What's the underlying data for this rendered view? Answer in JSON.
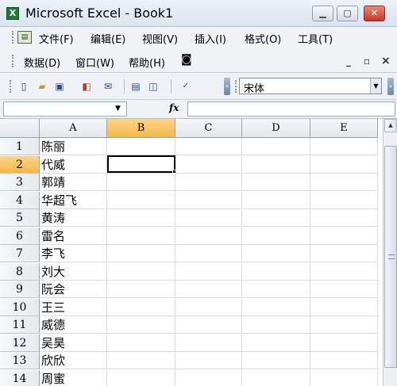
{
  "window": {
    "app_icon": "excel-icon",
    "title": "Microsoft Excel - Book1",
    "minimize_icon": "minimize-icon",
    "maximize_icon": "maximize-icon",
    "close_icon": "close-icon"
  },
  "menubar": {
    "doc_icon": "document-icon",
    "row1": [
      "文件(F)",
      "编辑(E)",
      "视图(V)",
      "插入(I)",
      "格式(O)",
      "工具(T)"
    ],
    "row2": [
      "数据(D)",
      "窗口(W)",
      "帮助(H)"
    ],
    "camera_icon": "camera-icon",
    "mdi_minimize": "_",
    "mdi_restore": "▫",
    "mdi_close": "×"
  },
  "toolbar": {
    "icons": [
      "new-icon",
      "open-icon",
      "save-icon",
      "permission-icon",
      "email-icon",
      "print-icon",
      "print-preview-icon",
      "spelling-icon"
    ],
    "font": "宋体"
  },
  "formula_bar": {
    "name_box": "",
    "fx_label": "fx",
    "formula": ""
  },
  "sheet": {
    "columns": [
      "A",
      "B",
      "C",
      "D",
      "E"
    ],
    "active_column": "B",
    "active_row": 2,
    "rows": [
      {
        "num": "1",
        "a": "陈丽"
      },
      {
        "num": "2",
        "a": "代威"
      },
      {
        "num": "3",
        "a": "郭靖"
      },
      {
        "num": "4",
        "a": "华超飞"
      },
      {
        "num": "5",
        "a": "黄涛"
      },
      {
        "num": "6",
        "a": "雷名"
      },
      {
        "num": "7",
        "a": "李飞"
      },
      {
        "num": "8",
        "a": "刘大"
      },
      {
        "num": "9",
        "a": "阮会"
      },
      {
        "num": "10",
        "a": "王三"
      },
      {
        "num": "11",
        "a": "威德"
      },
      {
        "num": "12",
        "a": "吴昊"
      },
      {
        "num": "13",
        "a": "欣欣"
      },
      {
        "num": "14",
        "a": "周蜜"
      }
    ]
  }
}
